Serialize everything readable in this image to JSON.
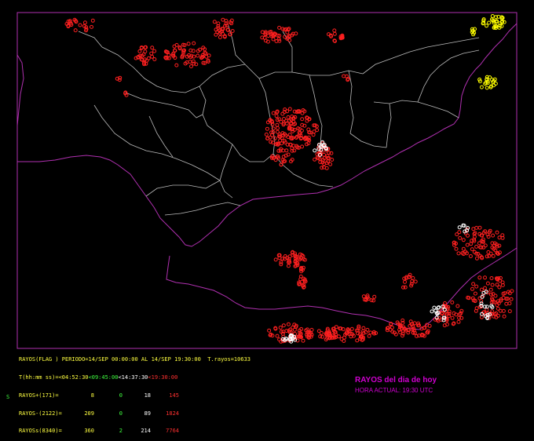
{
  "map": {
    "title": "RAYOS del dia de hoy",
    "hora_actual": "HORA ACTUAL: 19:30 UTC",
    "corner_label": "S",
    "colors": {
      "background": "#000000",
      "land_border": "#bbbbbb",
      "coast_frame": "#b030b0",
      "strike_recent": "#ff2020",
      "strike_latest": "#ffffff",
      "strike_earlier": "#ffff00",
      "green": "#00c000",
      "title_magenta": "#d000d0"
    }
  },
  "stats": {
    "header": "RAYOS(FLAG ) PERIODO=14/SEP 00:00:00 AL 14/SEP 19:30:00  T.rayos=10633",
    "time_row": {
      "label": "T(hh:mm ss)=",
      "a": "<04:52:30",
      "b": "<09:45:00",
      "c": "<14:37:30",
      "d": "<19:30:00"
    },
    "rows": [
      {
        "label": "RAYOS+(171)=",
        "v1": "8",
        "v2": "0",
        "v3": "18",
        "v4": "145"
      },
      {
        "label": "RAYOS-(2122)=",
        "v1": "209",
        "v2": "0",
        "v3": "89",
        "v4": "1824"
      },
      {
        "label": "RAYOSs(8340)=",
        "v1": "360",
        "v2": "2",
        "v3": "214",
        "v4": "7764"
      }
    ]
  }
}
